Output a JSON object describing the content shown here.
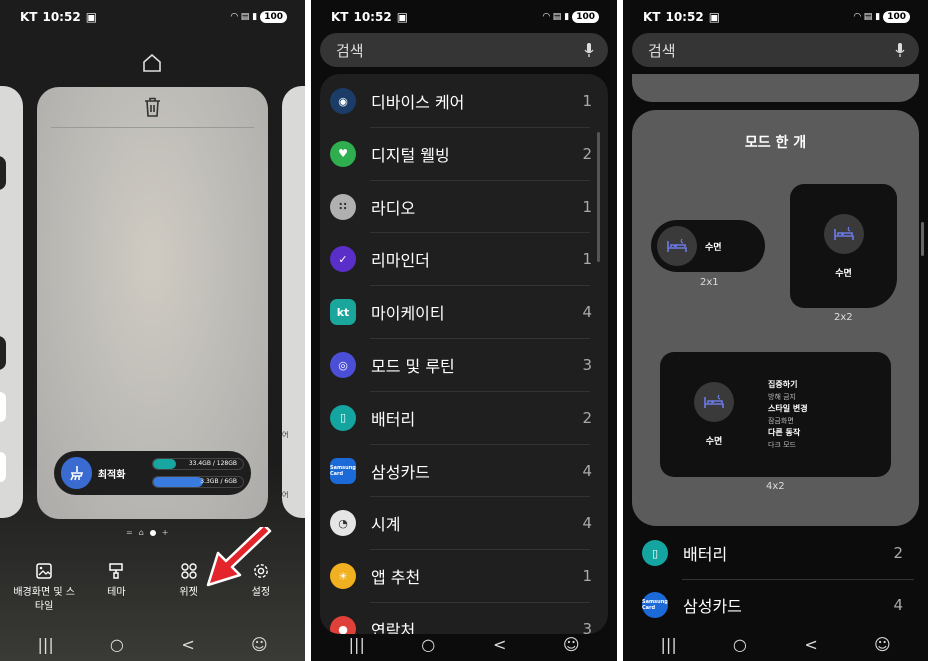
{
  "status": {
    "carrier": "KT",
    "time": "10:52",
    "battery": "100"
  },
  "panel1": {
    "optimize_label": "최적화",
    "storage_bar": "33.4GB / 128GB",
    "ram_bar": "3.3GB / 6GB",
    "storage_fraction": 0.26,
    "ram_fraction": 0.55,
    "page_indicator": "=",
    "page_plus": "+",
    "side_right_text_1": "어",
    "side_right_text_2": "어",
    "menu": [
      {
        "label": "배경화면 및 스타일",
        "icon": "wallpaper-icon"
      },
      {
        "label": "테마",
        "icon": "theme-brush-icon"
      },
      {
        "label": "위젯",
        "icon": "widgets-icon"
      },
      {
        "label": "설정",
        "icon": "settings-gear-icon"
      }
    ]
  },
  "panel2": {
    "search_placeholder": "검색",
    "apps": [
      {
        "name": "디바이스 케어",
        "count": "1",
        "color": "#1a3c66"
      },
      {
        "name": "디지털 웰빙",
        "count": "2",
        "color": "#2fae4f"
      },
      {
        "name": "라디오",
        "count": "1",
        "color": "#b0b0b0"
      },
      {
        "name": "리마인더",
        "count": "1",
        "color": "#5a2fc9"
      },
      {
        "name": "마이케이티",
        "count": "4",
        "color": "#1aa69a"
      },
      {
        "name": "모드 및 루틴",
        "count": "3",
        "color": "#4b4fd6"
      },
      {
        "name": "배터리",
        "count": "2",
        "color": "#14a5a0"
      },
      {
        "name": "삼성카드",
        "count": "4",
        "color": "#1b6ad8"
      },
      {
        "name": "시계",
        "count": "4",
        "color": "#e5e5e5"
      },
      {
        "name": "앱 추천",
        "count": "1",
        "color": "#f0b020"
      },
      {
        "name": "연락처",
        "count": "3",
        "color": "#e0403a"
      }
    ],
    "kt_text": "kt",
    "card_text": "Samsung Card"
  },
  "panel3": {
    "search_placeholder": "검색",
    "widget_title": "모드 한 개",
    "mode_label": "수면",
    "sizes": {
      "s2x1": "2x1",
      "s2x2": "2x2",
      "s4x2": "4x2"
    },
    "details": [
      {
        "title": "집중하기",
        "sub": "방해 금지"
      },
      {
        "title": "스타일 변경",
        "sub": "잠금화면"
      },
      {
        "title": "다른 동작",
        "sub": "다크 모드"
      }
    ],
    "apps": [
      {
        "name": "배터리",
        "count": "2",
        "color": "#14a5a0"
      },
      {
        "name": "삼성카드",
        "count": "4",
        "color": "#1b6ad8"
      }
    ]
  },
  "navbar": {
    "recents": "|||",
    "back": "<"
  }
}
